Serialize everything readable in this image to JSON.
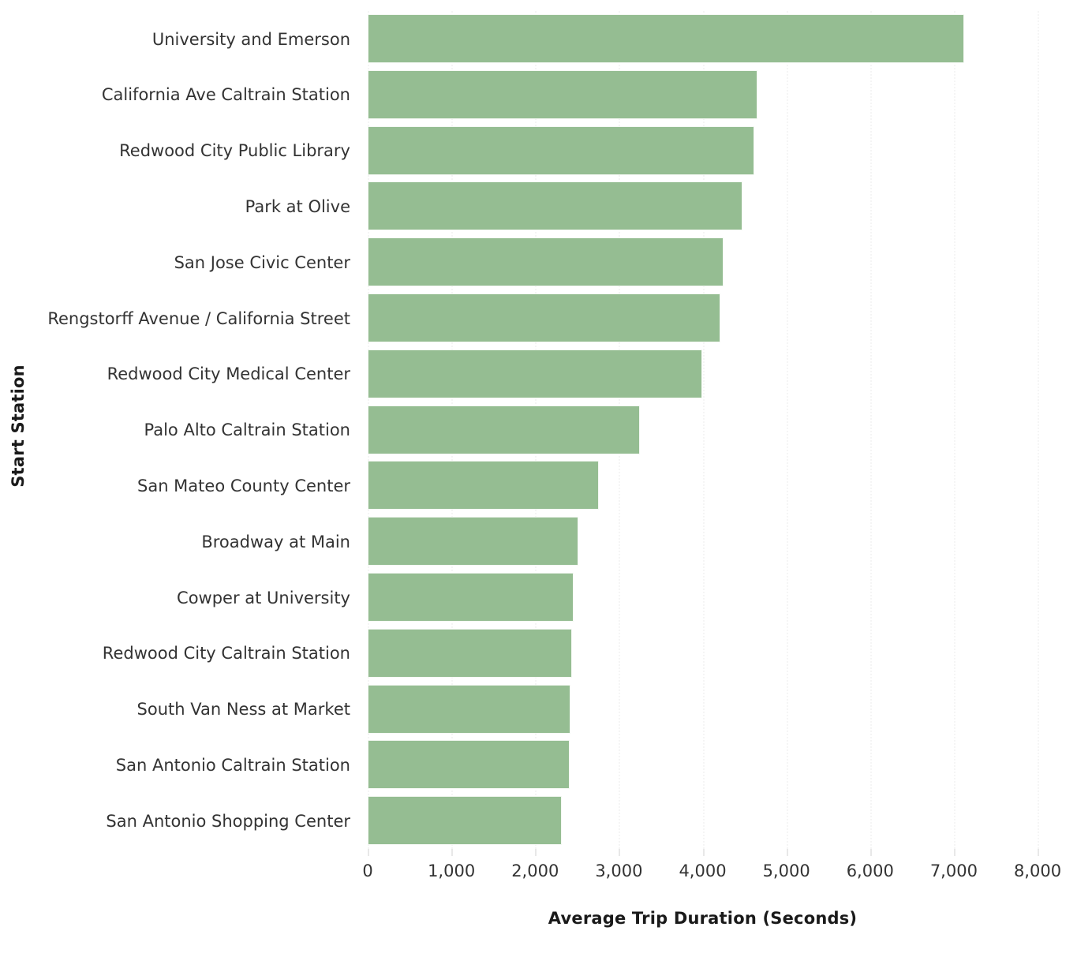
{
  "chart_data": {
    "type": "bar",
    "orientation": "horizontal",
    "title": "",
    "xlabel": "Average Trip Duration (Seconds)",
    "ylabel": "Start Station",
    "xlim": [
      0,
      8000
    ],
    "xticks": [
      0,
      1000,
      2000,
      3000,
      4000,
      5000,
      6000,
      7000,
      8000
    ],
    "xtick_labels": [
      "0",
      "1,000",
      "2,000",
      "3,000",
      "4,000",
      "5,000",
      "6,000",
      "7,000",
      "8,000"
    ],
    "grid": "x-axis dotted, very light",
    "legend": "none",
    "bar_color": "#95bd92",
    "bar_edge_color": "#f4f8f3",
    "categories": [
      "University and Emerson",
      "California Ave Caltrain Station",
      "Redwood City Public Library",
      "Park at Olive",
      "San Jose Civic Center",
      "Rengstorff Avenue / California Street",
      "Redwood City Medical Center",
      "Palo Alto Caltrain Station",
      "San Mateo County Center",
      "Broadway at Main",
      "Cowper at University",
      "Redwood City Caltrain Station",
      "South Van Ness at Market",
      "San Antonio Caltrain Station",
      "San Antonio Shopping Center"
    ],
    "values": [
      7106,
      4637,
      4600,
      4458,
      4231,
      4194,
      3978,
      3233,
      2743,
      2498,
      2441,
      2423,
      2404,
      2395,
      2300
    ]
  }
}
